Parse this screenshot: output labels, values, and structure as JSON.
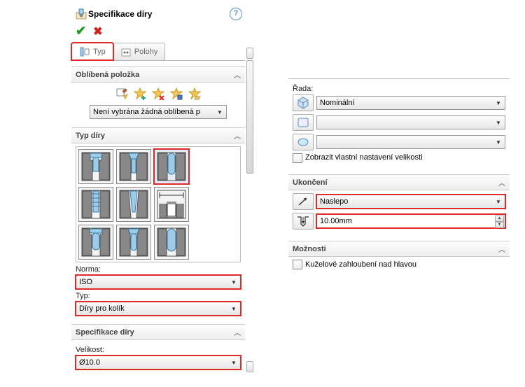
{
  "title": "Specifikace díry",
  "tabs": {
    "type": "Typ",
    "positions": "Polohy"
  },
  "sections": {
    "favorite": {
      "header": "Oblíbená položka",
      "dropdown": "Není vybrána žádná oblíbená p"
    },
    "holeType": {
      "header": "Typ díry"
    },
    "standard": {
      "label": "Norma:",
      "value": "ISO"
    },
    "type": {
      "label": "Typ:",
      "value": "Díry pro kolík"
    },
    "spec": {
      "header": "Specifikace díry",
      "sizeLabel": "Velikost:",
      "sizeValue": "Ø10.0"
    },
    "series": {
      "label": "Řada:",
      "value": "Nominální",
      "opt2": "",
      "opt3": ""
    },
    "showCustom": "Zobrazit vlastní nastavení velikosti",
    "end": {
      "header": "Ukončení",
      "value": "Naslepo",
      "depth": "10.00mm"
    },
    "options": {
      "header": "Možnosti",
      "opt1": "Kuželové zahloubení nad hlavou"
    }
  }
}
